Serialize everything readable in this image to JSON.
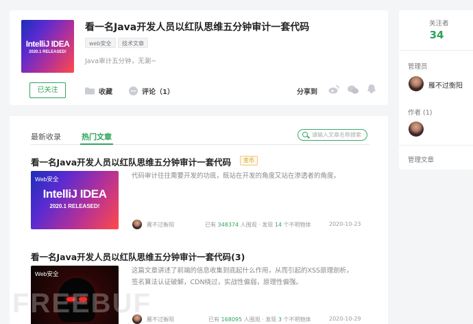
{
  "header_article": {
    "title": "看一名Java开发人员以红队思维五分钟审计一套代码",
    "tags": [
      "web安全",
      "技术文章"
    ],
    "summary": "Java审计五分钟，无涮~",
    "cover": {
      "line1": "IntelliJ IDEA",
      "line2": "2020.1 RELEASED!"
    },
    "actions": {
      "follow": "已关注",
      "favorite": "收藏",
      "comment": "评论（1）",
      "share": "分享到"
    }
  },
  "list": {
    "tabs": [
      "最新收录",
      "热门文章"
    ],
    "active_tab": "热门文章",
    "search_placeholder": "请输入文章名称搜索",
    "articles": [
      {
        "title": "看一名Java开发人员以红队思维五分钟审计一套代码",
        "badge": "金币",
        "cover_badge": "Web安全",
        "cover_line1": "IntelliJ IDEA",
        "cover_line2": "2020.1 RELEASED!",
        "excerpt": "代码审计往往需要开发的功底，既站在开发的角度又站在渗透者的角度。",
        "author": "雁不过衡阳",
        "views_prefix": "已有",
        "views": "348374",
        "views_suffix": "人围观",
        "finds_prefix": "· 发现",
        "finds": "14",
        "finds_suffix": "个不明物体",
        "date": "2020-10-23"
      },
      {
        "title": "看一名Java开发人员以红队思维五分钟审计一套代码(3)",
        "cover_badge": "Web安全",
        "excerpt_line1": "这篇文章讲述了前端的信息收集到底起什么作用，从而引起的XSS原理剖析，",
        "excerpt_line2": "签名算法认证破解，CDN绕过，实战性偏弱，原理性偏强。",
        "author": "雁不过衡阳",
        "views_prefix": "已有",
        "views": "168095",
        "views_suffix": "人围观",
        "finds_prefix": "· 发现",
        "finds": "3",
        "finds_suffix": "个不明物体",
        "date": "2020-10-29"
      }
    ]
  },
  "sidebar": {
    "follow_label": "关注者",
    "follow_count": "34",
    "admin_label": "管理员",
    "admin_name": "雁不过衡阳",
    "author_label": "作者 (1)",
    "manage_label": "管理文章"
  },
  "watermark": "FREEBUF",
  "colors": {
    "accent": "#2ea35a",
    "gold": "#d49b2a"
  }
}
